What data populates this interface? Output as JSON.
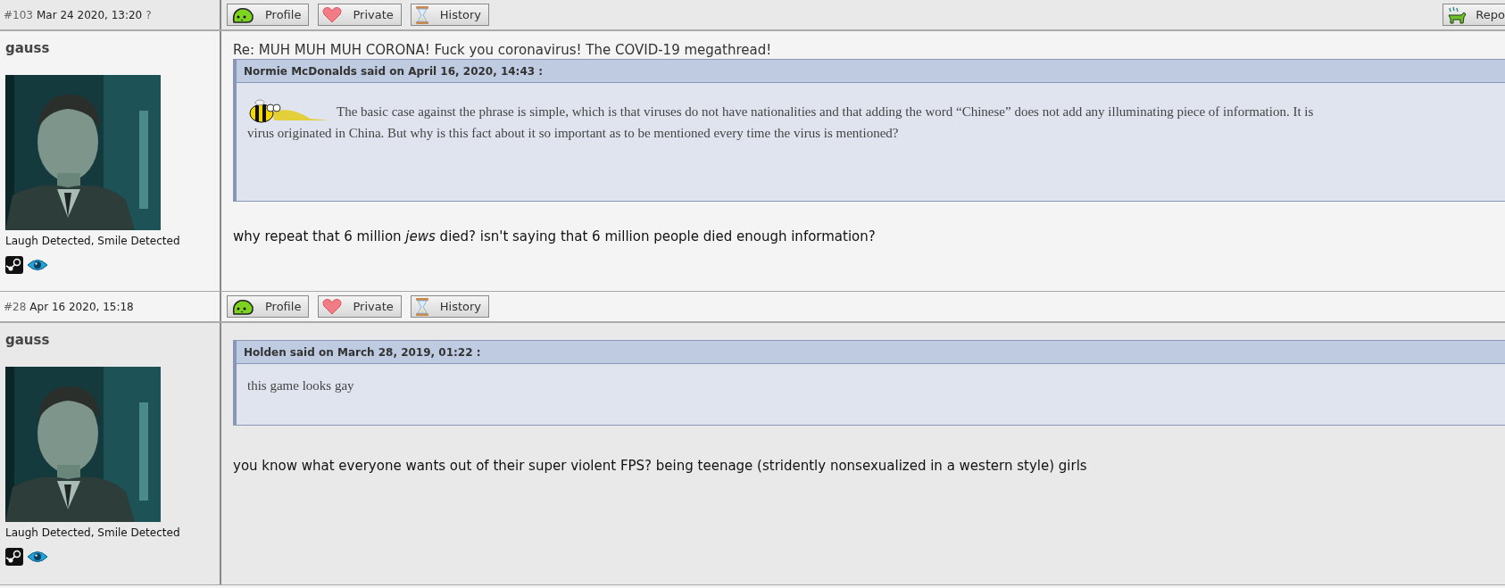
{
  "posts": [
    {
      "number": "#103",
      "date": "Mar 24 2020, 13:20",
      "marker": "?",
      "buttons": [
        {
          "kind": "profile",
          "label": "Profile"
        },
        {
          "kind": "private",
          "label": "Private"
        },
        {
          "kind": "history",
          "label": "History"
        }
      ],
      "report": {
        "label": "Repo"
      },
      "author": {
        "name": "gauss",
        "caption": "Laugh Detected, Smile Detected",
        "badges": [
          {
            "kind": "steam"
          },
          {
            "kind": "eye"
          }
        ]
      },
      "title": "Re: MUH MUH MUH CORONA! Fuck you coronavirus! The COVID-19 megathread!",
      "quote": {
        "header": "Normie McDonalds said on April 16, 2020, 14:43 :",
        "lines": [
          {
            "kind": "emote",
            "text": "The basic case against the phrase is simple, which is that viruses do not have nationalities and that adding the word “Chinese” does not add any illuminating piece of information. It is"
          },
          {
            "kind": "plain",
            "text": "virus originated in China. But why is this fact about it so important as to be mentioned every time the virus is mentioned?"
          }
        ]
      },
      "body": "why repeat that 6 million *jews* died? isn't saying that 6 million people died enough information?"
    },
    {
      "number": "#28",
      "date": "Apr 16 2020, 15:18",
      "buttons": [
        {
          "kind": "profile",
          "label": "Profile"
        },
        {
          "kind": "private",
          "label": "Private"
        },
        {
          "kind": "history",
          "label": "History"
        }
      ],
      "author": {
        "name": "gauss",
        "caption": "Laugh Detected, Smile Detected",
        "badges": [
          {
            "kind": "steam"
          },
          {
            "kind": "eye"
          }
        ]
      },
      "quote": {
        "header": "Holden said on March 28, 2019, 01:22 :",
        "lines": [
          {
            "kind": "plain",
            "text": "this game looks gay"
          }
        ]
      },
      "body": "you know what everyone wants out of their super violent FPS? being teenage (stridently nonsexualized in a western style) girls"
    }
  ]
}
